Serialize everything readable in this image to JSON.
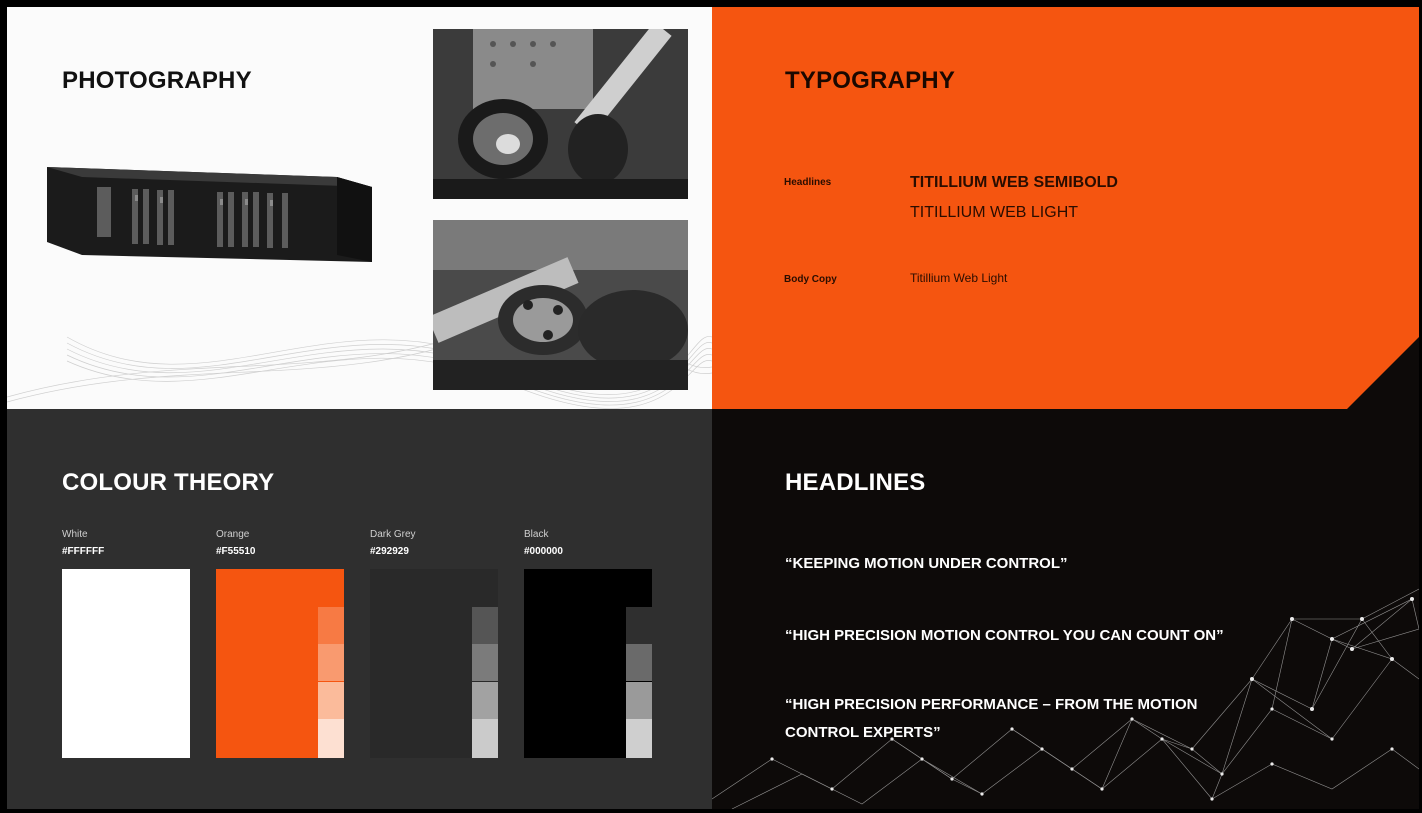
{
  "photography": {
    "title": "PHOTOGRAPHY"
  },
  "typography": {
    "title": "TYPOGRAPHY",
    "headlines_label": "Headlines",
    "headline_semibold": "TITILLIUM WEB SEMIBOLD",
    "headline_light": "TITILLIUM WEB LIGHT",
    "body_label": "Body Copy",
    "body_sample": "Titillium Web Light",
    "accent_color": "#f55510"
  },
  "colour_theory": {
    "title": "COLOUR THEORY",
    "swatches": [
      {
        "name": "White",
        "hex": "#FFFFFF",
        "color": "#ffffff"
      },
      {
        "name": "Orange",
        "hex": "#F55510",
        "color": "#f55510"
      },
      {
        "name": "Dark Grey",
        "hex": "#292929",
        "color": "#292929"
      },
      {
        "name": "Black",
        "hex": "#000000",
        "color": "#000000"
      }
    ]
  },
  "headlines": {
    "title": "HEADLINES",
    "items": [
      "“KEEPING MOTION UNDER CONTROL”",
      "“HIGH PRECISION MOTION CONTROL YOU CAN COUNT ON”",
      "“HIGH PRECISION PERFORMANCE – FROM THE MOTION CONTROL EXPERTS”"
    ]
  }
}
